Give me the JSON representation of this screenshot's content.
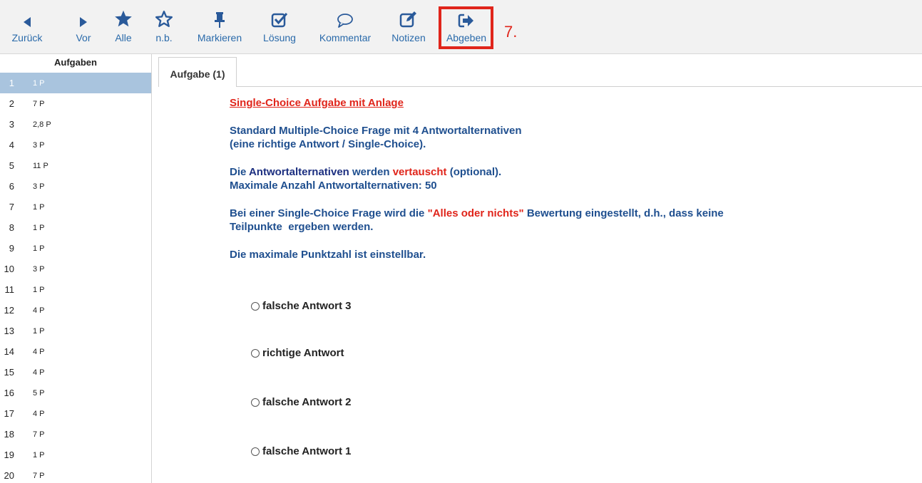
{
  "toolbar": {
    "buttons": [
      {
        "label": "Zurück",
        "icon": "triangle-left-icon"
      },
      {
        "label": "Vor",
        "icon": "triangle-right-icon"
      },
      {
        "label": "Alle",
        "icon": "star-filled-icon"
      },
      {
        "label": "n.b.",
        "icon": "star-outline-icon"
      },
      {
        "label": "Markieren",
        "icon": "pin-icon"
      },
      {
        "label": "Lösung",
        "icon": "checkbox-icon"
      },
      {
        "label": "Kommentar",
        "icon": "speech-bubble-icon"
      },
      {
        "label": "Notizen",
        "icon": "edit-note-icon"
      },
      {
        "label": "Abgeben",
        "icon": "sign-out-icon"
      }
    ],
    "step_label": "7.",
    "accent_color": "#2a5a9a",
    "highlight_color": "#e0251b"
  },
  "sidebar": {
    "header": "Aufgaben",
    "active_index": 0,
    "items": [
      {
        "num": "1",
        "points": "1 P"
      },
      {
        "num": "2",
        "points": "7 P"
      },
      {
        "num": "3",
        "points": "2,8 P"
      },
      {
        "num": "4",
        "points": "3 P"
      },
      {
        "num": "5",
        "points": "11 P"
      },
      {
        "num": "6",
        "points": "3 P"
      },
      {
        "num": "7",
        "points": "1 P"
      },
      {
        "num": "8",
        "points": "1 P"
      },
      {
        "num": "9",
        "points": "1 P"
      },
      {
        "num": "10",
        "points": "3 P"
      },
      {
        "num": "11",
        "points": "1 P"
      },
      {
        "num": "12",
        "points": "4 P"
      },
      {
        "num": "13",
        "points": "1 P"
      },
      {
        "num": "14",
        "points": "4 P"
      },
      {
        "num": "15",
        "points": "4 P"
      },
      {
        "num": "16",
        "points": "5 P"
      },
      {
        "num": "17",
        "points": "4 P"
      },
      {
        "num": "18",
        "points": "7 P"
      },
      {
        "num": "19",
        "points": "1 P"
      },
      {
        "num": "20",
        "points": "7 P"
      }
    ]
  },
  "main": {
    "tab_label": "Aufgabe (1)",
    "title": "Single-Choice Aufgabe mit Anlage",
    "p1_line1": "Standard Multiple-Choice Frage mit 4 Antwortalternativen",
    "p1_line2": "(eine richtige Antwort / Single-Choice).",
    "p2_word1": "Die",
    "p2_word2": "Antwortalternativen",
    "p2_word3": "werden",
    "p2_word4": "vertauscht",
    "p2_word5": "(optional).",
    "p2_line2": "Maximale Anzahl Antwortalternativen: 50",
    "p3_a": "Bei einer Single-Choice Frage wird die",
    "p3_b": "\"Alles oder nichts\"",
    "p3_c": "Bewertung eingestellt, d.h., dass keine",
    "p3_line2": "Teilpunkte  ergeben werden.",
    "p4": "Die maximale Punktzahl ist einstellbar.",
    "options": [
      "falsche Antwort 3",
      "richtige Antwort",
      "falsche Antwort 2",
      "falsche Antwort 1"
    ]
  }
}
